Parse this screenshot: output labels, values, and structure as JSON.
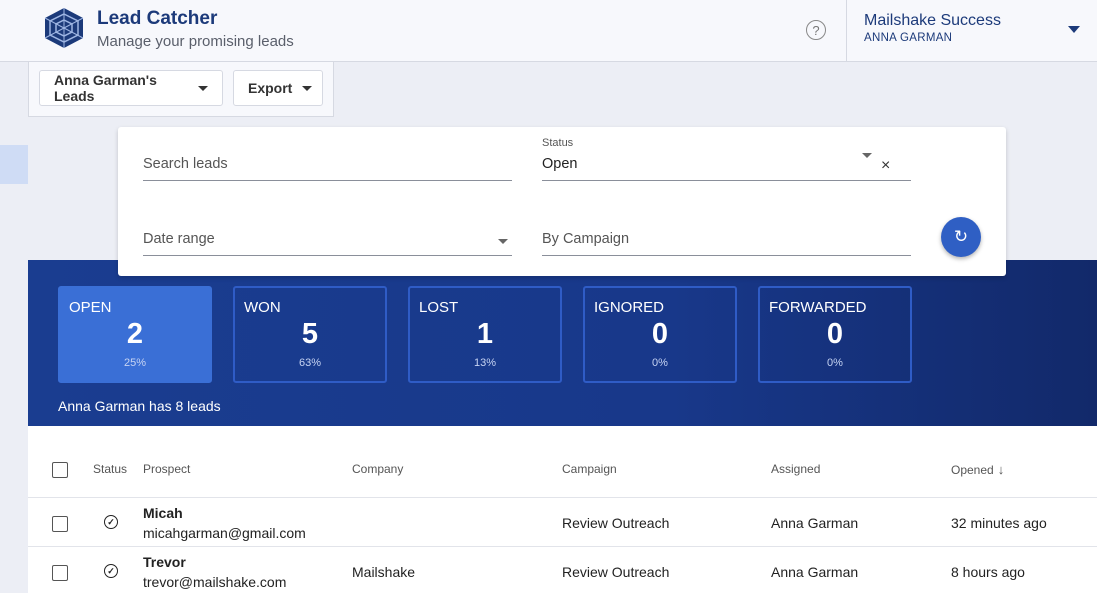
{
  "header": {
    "title": "Lead Catcher",
    "subtitle": "Manage your promising leads",
    "help_label": "?",
    "account_name": "Mailshake Success",
    "account_user": "ANNA GARMAN"
  },
  "toolbar": {
    "leads_label": "Anna Garman's Leads",
    "export_label": "Export"
  },
  "filters": {
    "search_placeholder": "Search leads",
    "status_label": "Status",
    "status_value": "Open",
    "clear_label": "×",
    "date_range_placeholder": "Date range",
    "campaign_placeholder": "By Campaign",
    "refresh_icon": "↻"
  },
  "stats": [
    {
      "label": "OPEN",
      "count": "2",
      "pct": "25%"
    },
    {
      "label": "WON",
      "count": "5",
      "pct": "63%"
    },
    {
      "label": "LOST",
      "count": "1",
      "pct": "13%"
    },
    {
      "label": "IGNORED",
      "count": "0",
      "pct": "0%"
    },
    {
      "label": "FORWARDED",
      "count": "0",
      "pct": "0%"
    }
  ],
  "summary": "Anna Garman has 8 leads",
  "table": {
    "columns": {
      "status": "Status",
      "prospect": "Prospect",
      "company": "Company",
      "campaign": "Campaign",
      "assigned": "Assigned",
      "opened": "Opened",
      "sort_icon": "↓"
    },
    "rows": [
      {
        "name": "Micah",
        "email": "micahgarman@gmail.com",
        "company": "",
        "campaign": "Review Outreach",
        "assigned": "Anna Garman",
        "opened": "32 minutes ago"
      },
      {
        "name": "Trevor",
        "email": "trevor@mailshake.com",
        "company": "Mailshake",
        "campaign": "Review Outreach",
        "assigned": "Anna Garman",
        "opened": "8 hours ago"
      }
    ]
  }
}
